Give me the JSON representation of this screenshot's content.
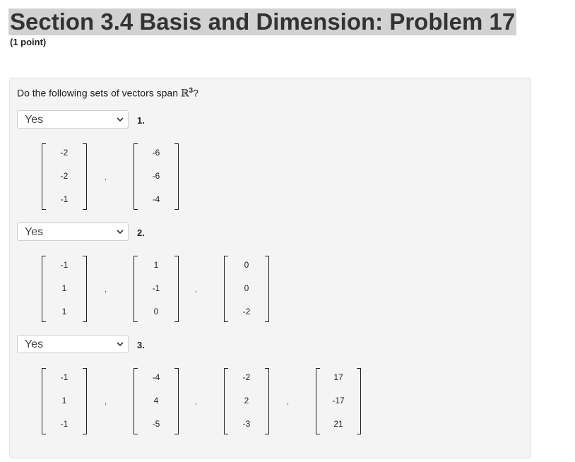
{
  "header": {
    "title": "Section 3.4 Basis and Dimension: Problem 17",
    "points": "(1 point)"
  },
  "question": {
    "text": "Do the following sets of vectors span ",
    "space_symbol": "ℝ",
    "exponent": "3",
    "suffix": "?"
  },
  "problems": [
    {
      "label": "1.",
      "answer": "Yes",
      "vectors": [
        [
          "-2",
          "-2",
          "-1"
        ],
        [
          "-6",
          "-6",
          "-4"
        ]
      ]
    },
    {
      "label": "2.",
      "answer": "Yes",
      "vectors": [
        [
          "-1",
          "1",
          "1"
        ],
        [
          "1",
          "-1",
          "0"
        ],
        [
          "0",
          "0",
          "-2"
        ]
      ]
    },
    {
      "label": "3.",
      "answer": "Yes",
      "vectors": [
        [
          "-1",
          "1",
          "-1"
        ],
        [
          "-4",
          "4",
          "-5"
        ],
        [
          "-2",
          "2",
          "-3"
        ],
        [
          "17",
          "-17",
          "21"
        ]
      ]
    }
  ],
  "separator": ","
}
